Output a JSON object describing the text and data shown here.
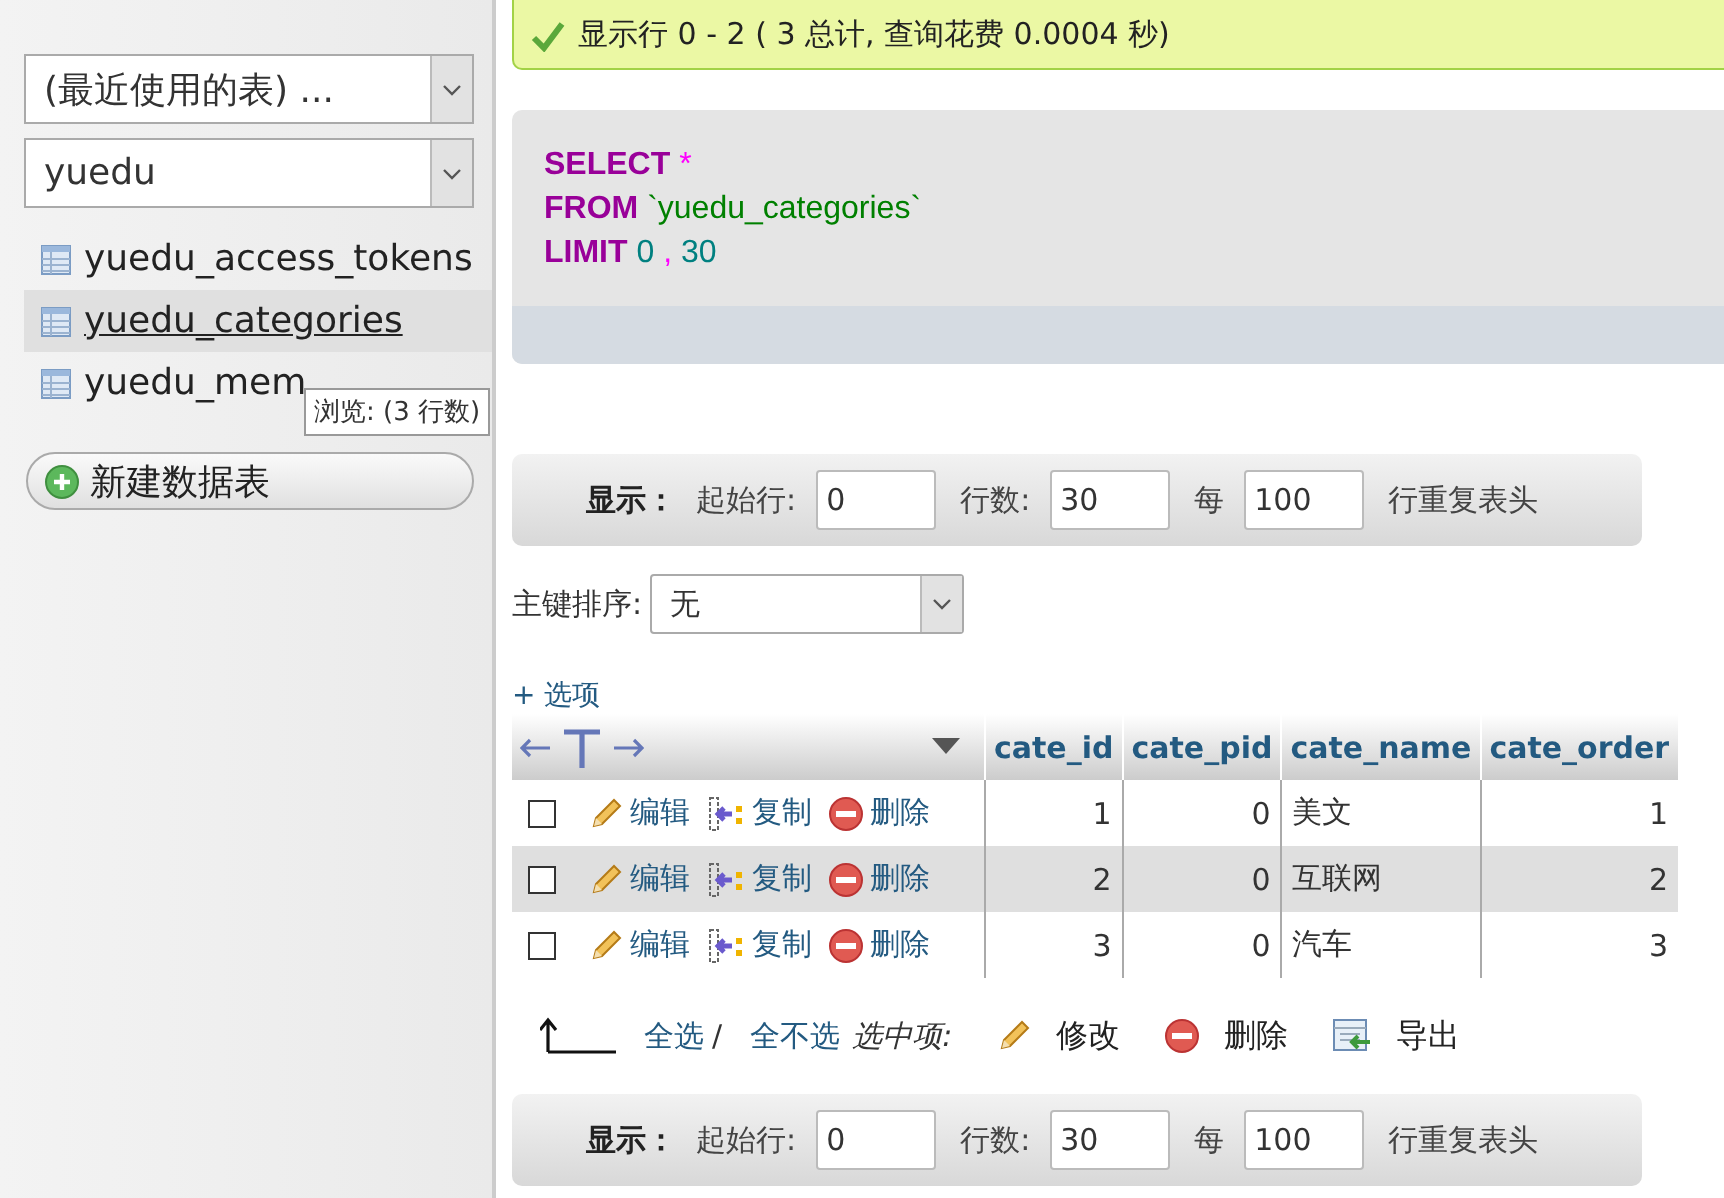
{
  "sidebar": {
    "recent_select": {
      "value": "(最近使用的表) ..."
    },
    "db_select": {
      "value": "yuedu"
    },
    "tables": [
      {
        "name": "yuedu_access_tokens",
        "selected": false
      },
      {
        "name": "yuedu_categories",
        "selected": true
      },
      {
        "name": "yuedu_mem",
        "selected": false
      }
    ],
    "tooltip": "浏览: (3 行数)",
    "new_table_button": "新建数据表"
  },
  "message": "显示行 0 - 2 ( 3 总计, 查询花费 0.0004 秒)",
  "sql": [
    [
      {
        "kind": "keyword",
        "text": "SELECT"
      },
      {
        "kind": "operator",
        "text": "*"
      }
    ],
    [
      {
        "kind": "keyword",
        "text": "FROM"
      },
      {
        "kind": "identifier",
        "text": "`yuedu_categories`"
      }
    ],
    [
      {
        "kind": "keyword",
        "text": "LIMIT"
      },
      {
        "kind": "number",
        "text": "0"
      },
      {
        "kind": "operator",
        "text": ","
      },
      {
        "kind": "number",
        "text": "30"
      }
    ]
  ],
  "nav_bars": [
    {
      "label": "显示：",
      "start_label": "起始行:",
      "start": "0",
      "rows_label": "行数:",
      "rows": "30",
      "per_label": "每",
      "per": "100",
      "repeat_label": "行重复表头"
    },
    {
      "label": "显示：",
      "start_label": "起始行:",
      "start": "0",
      "rows_label": "行数:",
      "rows": "30",
      "per_label": "每",
      "per": "100",
      "repeat_label": "行重复表头"
    }
  ],
  "sort": {
    "label": "主键排序:",
    "value": "无"
  },
  "options_link": "+ 选项",
  "table": {
    "columns": [
      "cate_id",
      "cate_pid",
      "cate_name",
      "cate_order"
    ],
    "rows": [
      {
        "checked": false,
        "actions": [
          {
            "kind": "edit",
            "label": "编辑"
          },
          {
            "kind": "copy",
            "label": "复制"
          },
          {
            "kind": "delete",
            "label": "删除"
          }
        ],
        "cells": [
          "1",
          "0",
          "美文",
          "1"
        ]
      },
      {
        "checked": false,
        "actions": [
          {
            "kind": "edit",
            "label": "编辑"
          },
          {
            "kind": "copy",
            "label": "复制"
          },
          {
            "kind": "delete",
            "label": "删除"
          }
        ],
        "cells": [
          "2",
          "0",
          "互联网",
          "2"
        ]
      },
      {
        "checked": false,
        "actions": [
          {
            "kind": "edit",
            "label": "编辑"
          },
          {
            "kind": "copy",
            "label": "复制"
          },
          {
            "kind": "delete",
            "label": "删除"
          }
        ],
        "cells": [
          "3",
          "0",
          "汽车",
          "3"
        ]
      }
    ]
  },
  "footer": {
    "select_all": "全选",
    "separator": "/",
    "deselect_all": "全不选",
    "with_selected": "选中项:",
    "actions": [
      {
        "kind": "edit",
        "label": "修改"
      },
      {
        "kind": "delete",
        "label": "删除"
      },
      {
        "kind": "export",
        "label": "导出"
      }
    ]
  }
}
